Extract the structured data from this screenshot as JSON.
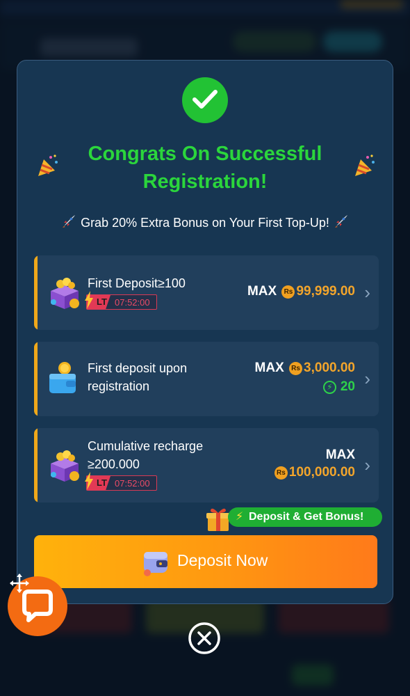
{
  "modal": {
    "title": "Congrats On Successful Registration!",
    "subtitle": "Grab 20% Extra Bonus on Your First Top-Up!"
  },
  "offers": [
    {
      "name": "First Deposit≥100",
      "max_label": "MAX",
      "currency": "Rs",
      "amount": "99,999.00",
      "lt_label": "LT",
      "timer": "07:52:00"
    },
    {
      "name": "First deposit upon registration",
      "max_label": "MAX",
      "currency": "Rs",
      "amount": "3,000.00",
      "bonus_points": "20"
    },
    {
      "name": "Cumulative recharge ≥200.000",
      "max_label": "MAX",
      "currency": "Rs",
      "amount": "100,000.00",
      "lt_label": "LT",
      "timer": "07:52:00"
    }
  ],
  "bonus_pill": "Deposit & Get Bonus!",
  "deposit_button": "Deposit Now",
  "colors": {
    "accent_green": "#2bd63c",
    "gold": "#f3a52b",
    "modal_bg": "#173652",
    "button_orange": "#ff9a10"
  },
  "icons": [
    "check-icon",
    "party-popper-icon",
    "rocket-icon",
    "treasure-chest-icon",
    "wallet-icon",
    "chevron-right-icon",
    "gift-icon",
    "chat-icon",
    "move-icon",
    "close-icon"
  ]
}
